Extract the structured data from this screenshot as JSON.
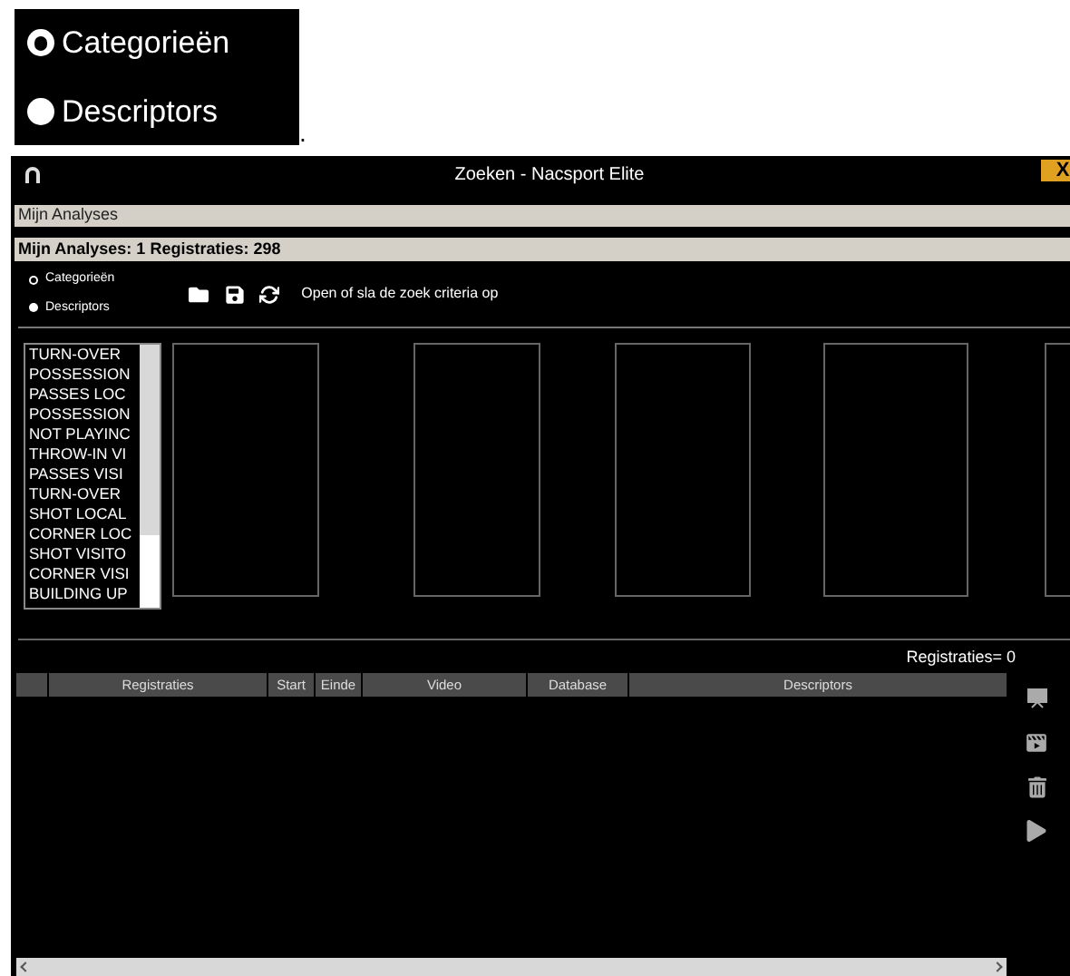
{
  "snippet": {
    "options": [
      {
        "label": "Categorieën",
        "selected": true
      },
      {
        "label": "Descriptors",
        "selected": false
      }
    ],
    "trailing": "."
  },
  "window": {
    "title": "Zoeken - Nacsport Elite",
    "close": "X"
  },
  "breadcrumb": "Mijn Analyses",
  "summary": "Mijn Analyses: 1 Registraties: 298",
  "options": [
    {
      "label": "Categorieën",
      "selected": true
    },
    {
      "label": "Descriptors",
      "selected": false
    }
  ],
  "toolbar": {
    "hint": "Open of sla de zoek criteria op"
  },
  "category_list": [
    "TURN-OVER",
    "POSSESSION",
    "PASSES LOC",
    "POSSESSION",
    "NOT PLAYINC",
    "THROW-IN VI",
    "PASSES VISI",
    "TURN-OVER",
    "SHOT LOCAL",
    "CORNER LOC",
    "SHOT VISITO",
    "CORNER VISI",
    "BUILDING UP"
  ],
  "count": "Registraties= 0",
  "table": {
    "columns": [
      "",
      "Registraties",
      "Start",
      "Einde",
      "Video",
      "Database",
      "Descriptors"
    ]
  }
}
